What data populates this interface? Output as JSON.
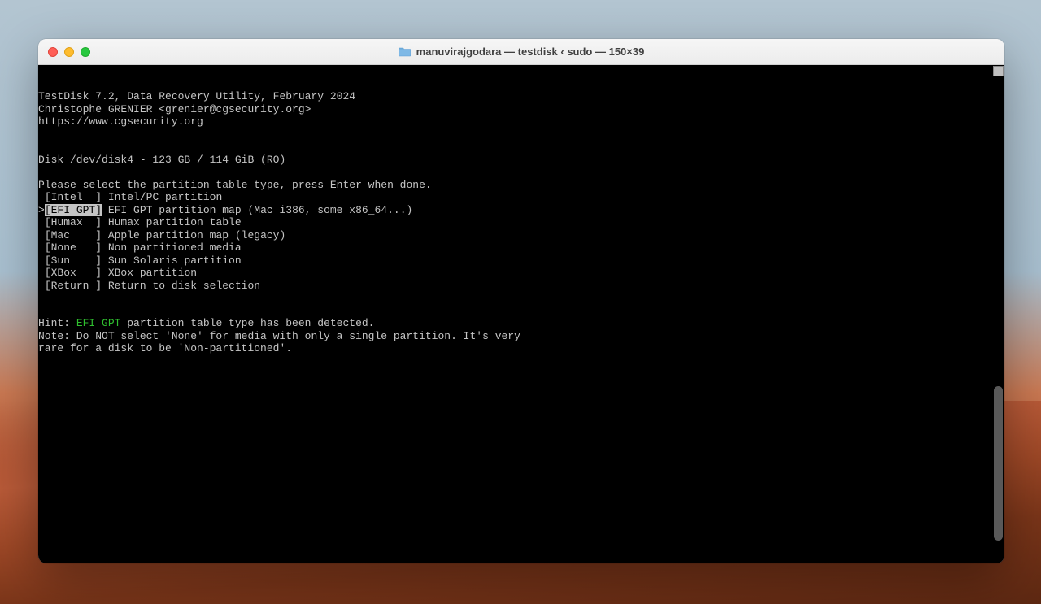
{
  "window": {
    "title": "manuvirajgodara — testdisk ‹ sudo — 150×39"
  },
  "header": {
    "line1": "TestDisk 7.2, Data Recovery Utility, February 2024",
    "line2": "Christophe GRENIER <grenier@cgsecurity.org>",
    "line3": "https://www.cgsecurity.org"
  },
  "disk_line": "Disk /dev/disk4 - 123 GB / 114 GiB (RO)",
  "prompt": "Please select the partition table type, press Enter when done.",
  "menu": [
    {
      "prefix": " ",
      "key": "[Intel  ]",
      "desc": " Intel/PC partition",
      "selected": false
    },
    {
      "prefix": ">",
      "key": "[EFI GPT]",
      "desc": " EFI GPT partition map (Mac i386, some x86_64...)",
      "selected": true
    },
    {
      "prefix": " ",
      "key": "[Humax  ]",
      "desc": " Humax partition table",
      "selected": false
    },
    {
      "prefix": " ",
      "key": "[Mac    ]",
      "desc": " Apple partition map (legacy)",
      "selected": false
    },
    {
      "prefix": " ",
      "key": "[None   ]",
      "desc": " Non partitioned media",
      "selected": false
    },
    {
      "prefix": " ",
      "key": "[Sun    ]",
      "desc": " Sun Solaris partition",
      "selected": false
    },
    {
      "prefix": " ",
      "key": "[XBox   ]",
      "desc": " XBox partition",
      "selected": false
    },
    {
      "prefix": " ",
      "key": "[Return ]",
      "desc": " Return to disk selection",
      "selected": false
    }
  ],
  "hint": {
    "label": "Hint: ",
    "highlighted": "EFI GPT",
    "rest": " partition table type has been detected."
  },
  "note_line1": "Note: Do NOT select 'None' for media with only a single partition. It's very",
  "note_line2": "rare for a disk to be 'Non-partitioned'."
}
